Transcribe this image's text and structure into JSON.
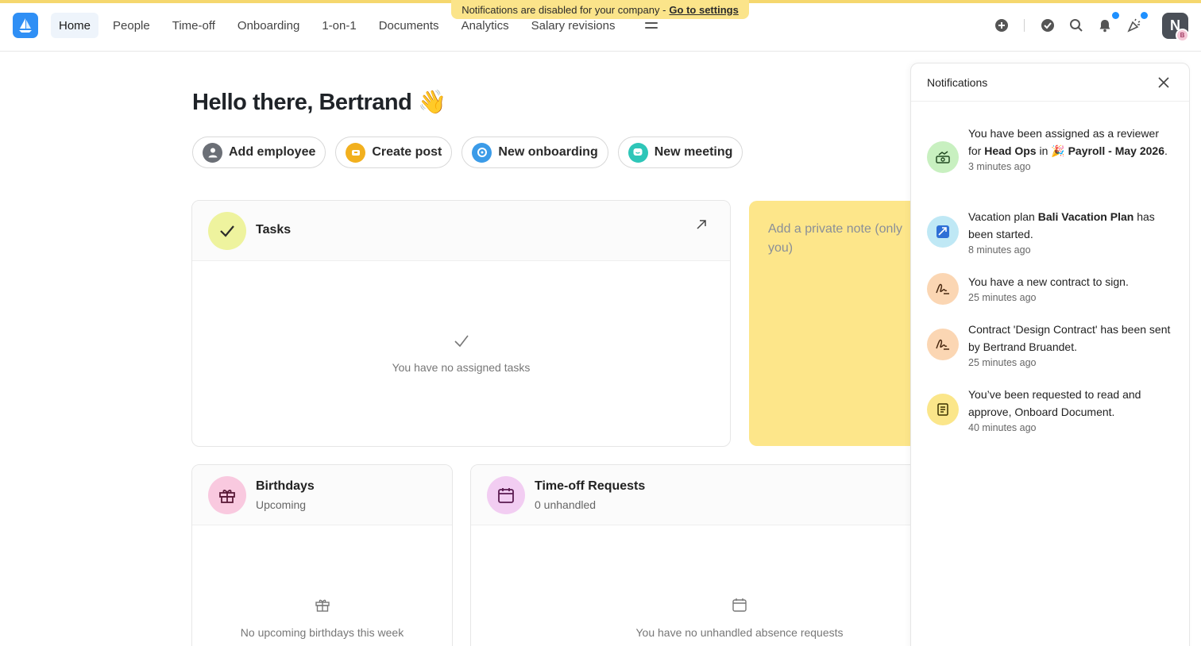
{
  "banner": {
    "text": "Notifications are disabled for your company -",
    "link": "Go to settings"
  },
  "nav": {
    "items": [
      {
        "label": "Home",
        "active": true
      },
      {
        "label": "People"
      },
      {
        "label": "Time-off"
      },
      {
        "label": "Onboarding"
      },
      {
        "label": "1-on-1"
      },
      {
        "label": "Documents"
      },
      {
        "label": "Analytics"
      },
      {
        "label": "Salary revisions"
      }
    ],
    "right_icons": [
      "plus-circle-icon",
      "check-circle-icon",
      "search-icon",
      "bell-icon",
      "party-icon"
    ],
    "avatar_letter": "N",
    "avatar_sub": "B"
  },
  "greeting": {
    "text": "Hello there, Bertrand",
    "emoji": "👋"
  },
  "actions": [
    {
      "label": "Add employee",
      "color": "#6b6f76"
    },
    {
      "label": "Create post",
      "color": "#f2b01e"
    },
    {
      "label": "New onboarding",
      "color": "#3b9be8"
    },
    {
      "label": "New meeting",
      "color": "#2ec6b8"
    }
  ],
  "tasks": {
    "title": "Tasks",
    "empty": "You have no assigned tasks"
  },
  "note": {
    "placeholder": "Add a private note (only you)"
  },
  "birthdays": {
    "title": "Birthdays",
    "subtitle": "Upcoming",
    "empty": "No upcoming birthdays this week"
  },
  "timeoff": {
    "title": "Time-off Requests",
    "subtitle": "0 unhandled",
    "empty": "You have no unhandled absence requests"
  },
  "notifications": {
    "title": "Notifications",
    "items": [
      {
        "pre": "You have been assigned as a reviewer for ",
        "b1": "Head Ops",
        "mid": " in 🎉 ",
        "b2": "Payroll - May 2026",
        "post": ".",
        "time": "3 minutes ago",
        "bg": "#c8f0c0"
      },
      {
        "pre": "Vacation plan ",
        "b1": "Bali Vacation Plan",
        "mid": " has been started.",
        "time": "8 minutes ago",
        "bg": "#bfe8f5"
      },
      {
        "pre": "You have a new contract to sign.",
        "time": "25 minutes ago",
        "bg": "#fbd6b3"
      },
      {
        "pre": "Contract 'Design Contract' has been sent by Bertrand Bruandet.",
        "time": "25 minutes ago",
        "bg": "#fbd6b3"
      },
      {
        "pre": "You’ve been requested to read and approve, Onboard Document.",
        "time": "40 minutes ago",
        "bg": "#fbe68a"
      }
    ]
  }
}
